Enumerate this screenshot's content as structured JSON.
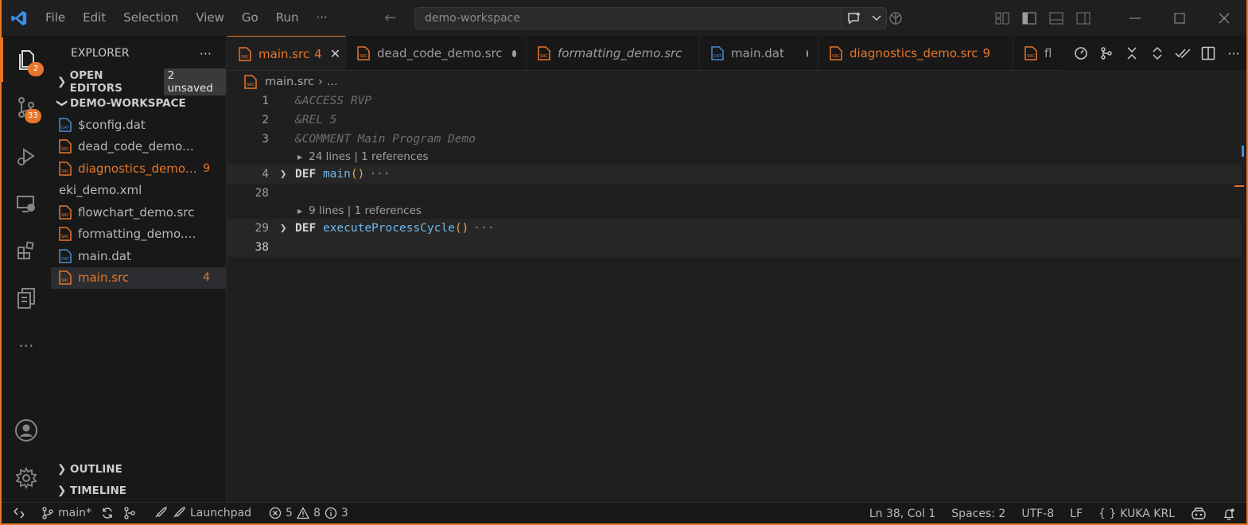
{
  "menu": [
    "File",
    "Edit",
    "Selection",
    "View",
    "Go",
    "Run",
    "···"
  ],
  "search": {
    "text": "demo-workspace"
  },
  "activity": {
    "explorer_badge": "2",
    "scm_badge": "33"
  },
  "sidebar": {
    "title": "EXPLORER",
    "more": "···",
    "open_editors": {
      "label": "OPEN EDITORS",
      "badge": "2 unsaved"
    },
    "workspace": {
      "label": "DEMO-WORKSPACE"
    },
    "files": [
      {
        "name": "$config.dat",
        "type": "dat",
        "status": "",
        "count": ""
      },
      {
        "name": "dead_code_demo.src",
        "type": "src",
        "status": "",
        "count": ""
      },
      {
        "name": "diagnostics_demo....",
        "type": "src",
        "status": "error",
        "count": "9"
      },
      {
        "name": "eki_demo.xml",
        "type": "none",
        "status": "",
        "count": ""
      },
      {
        "name": "flowchart_demo.src",
        "type": "src",
        "status": "",
        "count": ""
      },
      {
        "name": "formatting_demo.src",
        "type": "src",
        "status": "",
        "count": ""
      },
      {
        "name": "main.dat",
        "type": "dat",
        "status": "",
        "count": ""
      },
      {
        "name": "main.src",
        "type": "src",
        "status": "error",
        "count": "4"
      }
    ],
    "outline": "OUTLINE",
    "timeline": "TIMELINE"
  },
  "tabs": [
    {
      "label": "main.src",
      "count": "4",
      "active": true
    },
    {
      "label": "dead_code_demo.src",
      "dirty": true
    },
    {
      "label": "formatting_demo.src",
      "italic": true
    },
    {
      "label": "main.dat",
      "dirty": true
    },
    {
      "label": "diagnostics_demo.src",
      "count": "9"
    },
    {
      "label": "fl"
    }
  ],
  "breadcrumb": {
    "file": "main.src",
    "rest": "..."
  },
  "editor": {
    "lines": [
      {
        "num": "1",
        "text": "&ACCESS RVP"
      },
      {
        "num": "2",
        "text": "&REL 5"
      },
      {
        "num": "3",
        "text": "&COMMENT Main Program Demo"
      }
    ],
    "lens1": "24 lines | 1 references",
    "def1": {
      "num": "4",
      "kw": "DEF",
      "name": "main",
      "parens": "()",
      "ellipsis": "···"
    },
    "line28": "28",
    "lens2": "9 lines | 1 references",
    "def2": {
      "num": "29",
      "kw": "DEF",
      "name": "executeProcessCycle",
      "parens": "()",
      "ellipsis": "···"
    },
    "line38": "38"
  },
  "status": {
    "branch": "main*",
    "launchpad": "Launchpad",
    "errors": "5",
    "warnings": "8",
    "infos": "3",
    "position": "Ln 38, Col 1",
    "spaces": "Spaces: 2",
    "encoding": "UTF-8",
    "eol": "LF",
    "language": "KUKA KRL"
  },
  "colors": {
    "accent": "#e8762a",
    "background": "#1f1f1f",
    "sidebar": "#181818",
    "function": "#6fb7e9"
  }
}
